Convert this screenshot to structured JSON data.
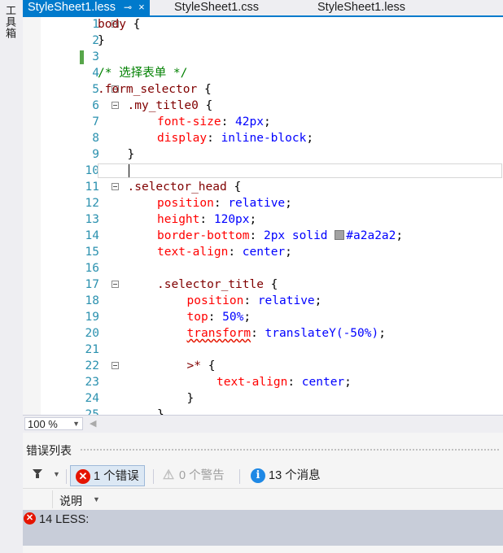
{
  "toolbox": {
    "label": "工具箱"
  },
  "tabs": [
    {
      "label": "StyleSheet1.less",
      "active": true,
      "pin": "⊸",
      "close": "×"
    },
    {
      "label": "StyleSheet1.css",
      "active": false
    },
    {
      "label": "StyleSheet1.less",
      "active": false
    }
  ],
  "editor": {
    "current_line": 10,
    "lines": [
      {
        "n": "1",
        "fold": true,
        "indent": 0,
        "tokens": [
          {
            "t": "body",
            "c": "sel"
          },
          {
            "t": " {",
            "c": ""
          }
        ]
      },
      {
        "n": "2",
        "fold": false,
        "indent": 0,
        "tokens": [
          {
            "t": "}",
            "c": ""
          }
        ]
      },
      {
        "n": "3",
        "fold": false,
        "indent": 0,
        "tokens": []
      },
      {
        "n": "4",
        "fold": false,
        "indent": 0,
        "tokens": [
          {
            "t": "/* 选择表单 */",
            "c": "com"
          }
        ]
      },
      {
        "n": "5",
        "fold": true,
        "indent": 0,
        "tokens": [
          {
            "t": ".form_selector",
            "c": "sel"
          },
          {
            "t": " {",
            "c": ""
          }
        ]
      },
      {
        "n": "6",
        "fold": true,
        "indent": 1,
        "tokens": [
          {
            "t": ".my_title0",
            "c": "sel"
          },
          {
            "t": " {",
            "c": ""
          }
        ]
      },
      {
        "n": "7",
        "fold": false,
        "indent": 2,
        "tokens": [
          {
            "t": "font-size",
            "c": "prop"
          },
          {
            "t": ": ",
            "c": ""
          },
          {
            "t": "42px",
            "c": "val"
          },
          {
            "t": ";",
            "c": ""
          }
        ]
      },
      {
        "n": "8",
        "fold": false,
        "indent": 2,
        "tokens": [
          {
            "t": "display",
            "c": "prop"
          },
          {
            "t": ": ",
            "c": ""
          },
          {
            "t": "inline-block",
            "c": "val"
          },
          {
            "t": ";",
            "c": ""
          }
        ]
      },
      {
        "n": "9",
        "fold": false,
        "indent": 1,
        "tokens": [
          {
            "t": "}",
            "c": ""
          }
        ]
      },
      {
        "n": "10",
        "fold": false,
        "indent": 0,
        "tokens": []
      },
      {
        "n": "11",
        "fold": true,
        "indent": 1,
        "tokens": [
          {
            "t": ".selector_head",
            "c": "sel"
          },
          {
            "t": " {",
            "c": ""
          }
        ]
      },
      {
        "n": "12",
        "fold": false,
        "indent": 2,
        "tokens": [
          {
            "t": "position",
            "c": "prop"
          },
          {
            "t": ": ",
            "c": ""
          },
          {
            "t": "relative",
            "c": "val"
          },
          {
            "t": ";",
            "c": ""
          }
        ]
      },
      {
        "n": "13",
        "fold": false,
        "indent": 2,
        "tokens": [
          {
            "t": "height",
            "c": "prop"
          },
          {
            "t": ": ",
            "c": ""
          },
          {
            "t": "120px",
            "c": "val"
          },
          {
            "t": ";",
            "c": ""
          }
        ]
      },
      {
        "n": "14",
        "fold": false,
        "indent": 2,
        "tokens": [
          {
            "t": "border-bottom",
            "c": "prop"
          },
          {
            "t": ": ",
            "c": ""
          },
          {
            "t": "2px solid ",
            "c": "val"
          },
          {
            "t": "",
            "c": "swatch"
          },
          {
            "t": "#a2a2a2",
            "c": "val"
          },
          {
            "t": ";",
            "c": ""
          }
        ]
      },
      {
        "n": "15",
        "fold": false,
        "indent": 2,
        "tokens": [
          {
            "t": "text-align",
            "c": "prop"
          },
          {
            "t": ": ",
            "c": ""
          },
          {
            "t": "center",
            "c": "val"
          },
          {
            "t": ";",
            "c": ""
          }
        ]
      },
      {
        "n": "16",
        "fold": false,
        "indent": 0,
        "tokens": []
      },
      {
        "n": "17",
        "fold": true,
        "indent": 2,
        "tokens": [
          {
            "t": ".selector_title",
            "c": "sel"
          },
          {
            "t": " {",
            "c": ""
          }
        ]
      },
      {
        "n": "18",
        "fold": false,
        "indent": 3,
        "tokens": [
          {
            "t": "position",
            "c": "prop"
          },
          {
            "t": ": ",
            "c": ""
          },
          {
            "t": "relative",
            "c": "val"
          },
          {
            "t": ";",
            "c": ""
          }
        ]
      },
      {
        "n": "19",
        "fold": false,
        "indent": 3,
        "tokens": [
          {
            "t": "top",
            "c": "prop"
          },
          {
            "t": ": ",
            "c": ""
          },
          {
            "t": "50%",
            "c": "val"
          },
          {
            "t": ";",
            "c": ""
          }
        ]
      },
      {
        "n": "20",
        "fold": false,
        "indent": 3,
        "tokens": [
          {
            "t": "transform",
            "c": "prop squiggle"
          },
          {
            "t": ": ",
            "c": ""
          },
          {
            "t": "translateY(-50%)",
            "c": "val"
          },
          {
            "t": ";",
            "c": ""
          }
        ]
      },
      {
        "n": "21",
        "fold": false,
        "indent": 0,
        "tokens": []
      },
      {
        "n": "22",
        "fold": true,
        "indent": 3,
        "tokens": [
          {
            "t": ">*",
            "c": "sel"
          },
          {
            "t": " {",
            "c": ""
          }
        ]
      },
      {
        "n": "23",
        "fold": false,
        "indent": 4,
        "tokens": [
          {
            "t": "text-align",
            "c": "prop"
          },
          {
            "t": ": ",
            "c": ""
          },
          {
            "t": "center",
            "c": "val"
          },
          {
            "t": ";",
            "c": ""
          }
        ]
      },
      {
        "n": "24",
        "fold": false,
        "indent": 3,
        "tokens": [
          {
            "t": "}",
            "c": ""
          }
        ]
      },
      {
        "n": "25",
        "fold": false,
        "indent": 2,
        "tokens": [
          {
            "t": "}",
            "c": ""
          }
        ]
      }
    ]
  },
  "status": {
    "zoom": "100 %",
    "zoom_arrow": "▼",
    "scroll_left": "◀"
  },
  "error_panel": {
    "title": "错误列表",
    "filter_arrow": "▼",
    "errors_label": "1 个错误",
    "errors_icon": "✕",
    "warnings_label": "0 个警告",
    "warnings_icon": "⚠",
    "messages_label": "13 个消息",
    "messages_icon": "i",
    "column_description": "说明",
    "column_arrow": "▼",
    "rows": [
      {
        "icon": "✕",
        "text": "14 LESS:"
      }
    ]
  },
  "colors": {
    "accent": "#007acc",
    "selector": "#800000",
    "property": "#ff0000",
    "value": "#0000ff",
    "comment": "#008000",
    "line_number": "#2b91af",
    "swatch": "#a2a2a2"
  }
}
